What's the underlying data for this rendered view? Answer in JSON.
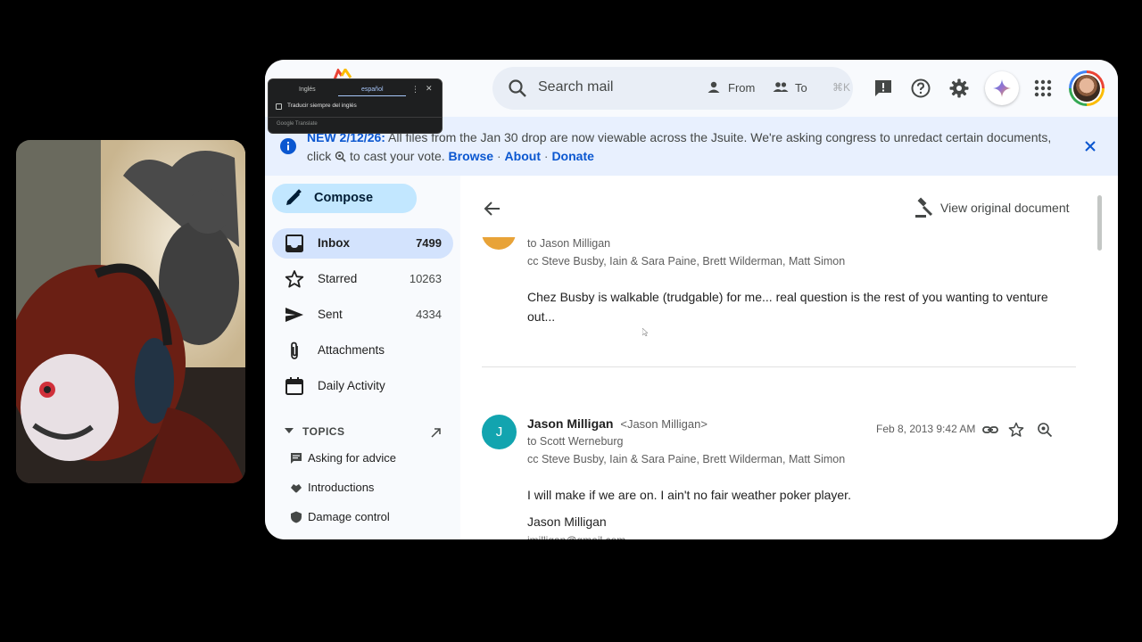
{
  "translate_popup": {
    "source_lang": "Inglés",
    "target_lang": "español",
    "always_translate": "Traducir siempre del inglés",
    "brand": "Google Translate"
  },
  "search": {
    "placeholder": "Search mail",
    "from_label": "From",
    "to_label": "To",
    "shortcut": "⌘K"
  },
  "banner": {
    "headline": "NEW 2/12/26:",
    "text1": " All files from the Jan 30 drop are now viewable across the Jsuite. We're asking congress to unredact certain documents, click ",
    "text2": " to cast your vote. ",
    "link_browse": "Browse",
    "link_about": "About",
    "link_donate": "Donate",
    "separator": " · "
  },
  "sidebar": {
    "compose": "Compose",
    "items": [
      {
        "label": "Inbox",
        "count": "7499"
      },
      {
        "label": "Starred",
        "count": "10263"
      },
      {
        "label": "Sent",
        "count": "4334"
      },
      {
        "label": "Attachments",
        "count": ""
      },
      {
        "label": "Daily Activity",
        "count": ""
      }
    ],
    "topics_header": "TOPICS",
    "topics": [
      {
        "label": "Asking for advice"
      },
      {
        "label": "Introductions"
      },
      {
        "label": "Damage control"
      }
    ]
  },
  "thread": {
    "view_original": "View original document",
    "msg1": {
      "to": "to Jason Milligan",
      "cc": "cc Steve Busby, Iain & Sara Paine, Brett Wilderman, Matt Simon",
      "body": "Chez Busby is walkable (trudgable) for me... real question is the rest of you wanting to venture out..."
    },
    "msg2": {
      "avatar_letter": "J",
      "name": "Jason Milligan",
      "email": "<Jason Milligan>",
      "date": "Feb 8, 2013 9:42 AM",
      "to": "to Scott Werneburg",
      "cc": "cc Steve Busby, Iain & Sara Paine, Brett Wilderman, Matt Simon",
      "body": "I will make if we are on. I ain't no fair weather poker player.",
      "signature": "Jason Milligan",
      "cut_line": "jmilligan@gmail.com"
    }
  },
  "colors": {
    "accent": "#0b57d0",
    "banner_bg": "#e8f0fe",
    "compose_bg": "#c2e7ff",
    "inbox_active": "#d3e3fd",
    "avatar_teal": "#12a4af"
  }
}
